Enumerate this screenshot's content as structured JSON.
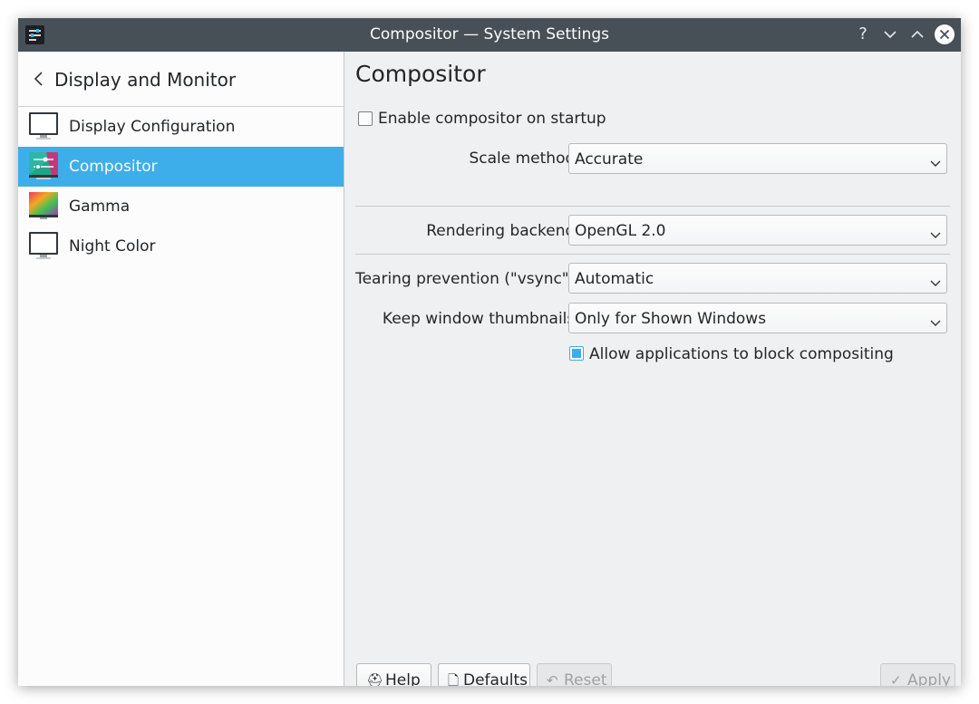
{
  "window": {
    "title": "Compositor — System Settings",
    "titlebar_buttons": {
      "help": "?",
      "minimize": "⌄",
      "maximize": "⌃",
      "close": "✕"
    }
  },
  "sidebar": {
    "header": "Display and Monitor",
    "items": [
      {
        "label": "Display Configuration",
        "icon": "monitor-icon",
        "selected": false
      },
      {
        "label": "Compositor",
        "icon": "compositor-icon",
        "selected": true
      },
      {
        "label": "Gamma",
        "icon": "gamma-icon",
        "selected": false
      },
      {
        "label": "Night Color",
        "icon": "night-color-icon",
        "selected": false
      }
    ]
  },
  "main": {
    "title": "Compositor",
    "enable_on_startup": {
      "label": "Enable compositor on startup",
      "checked": false
    },
    "scale_method": {
      "label": "Scale method:",
      "value": "Accurate"
    },
    "rendering_backend": {
      "label": "Rendering backend:",
      "value": "OpenGL 2.0"
    },
    "tearing_prevention": {
      "label": "Tearing prevention (\"vsync\"):",
      "value": "Automatic"
    },
    "keep_thumbnails": {
      "label": "Keep window thumbnails:",
      "value": "Only for Shown Windows"
    },
    "allow_block": {
      "label": "Allow applications to block compositing",
      "checked": true
    }
  },
  "footer": {
    "help": {
      "label": "Help",
      "icon": "⛑"
    },
    "defaults": {
      "label": "Defaults",
      "icon": "🗋"
    },
    "reset": {
      "label": "Reset",
      "icon": "↶",
      "enabled": false
    },
    "apply": {
      "label": "Apply",
      "icon": "✓",
      "enabled": false
    }
  },
  "colors": {
    "accent": "#3daee9",
    "titlebar": "#475057",
    "window_bg": "#eff0f1",
    "sidebar_bg": "#fcfcfc"
  }
}
